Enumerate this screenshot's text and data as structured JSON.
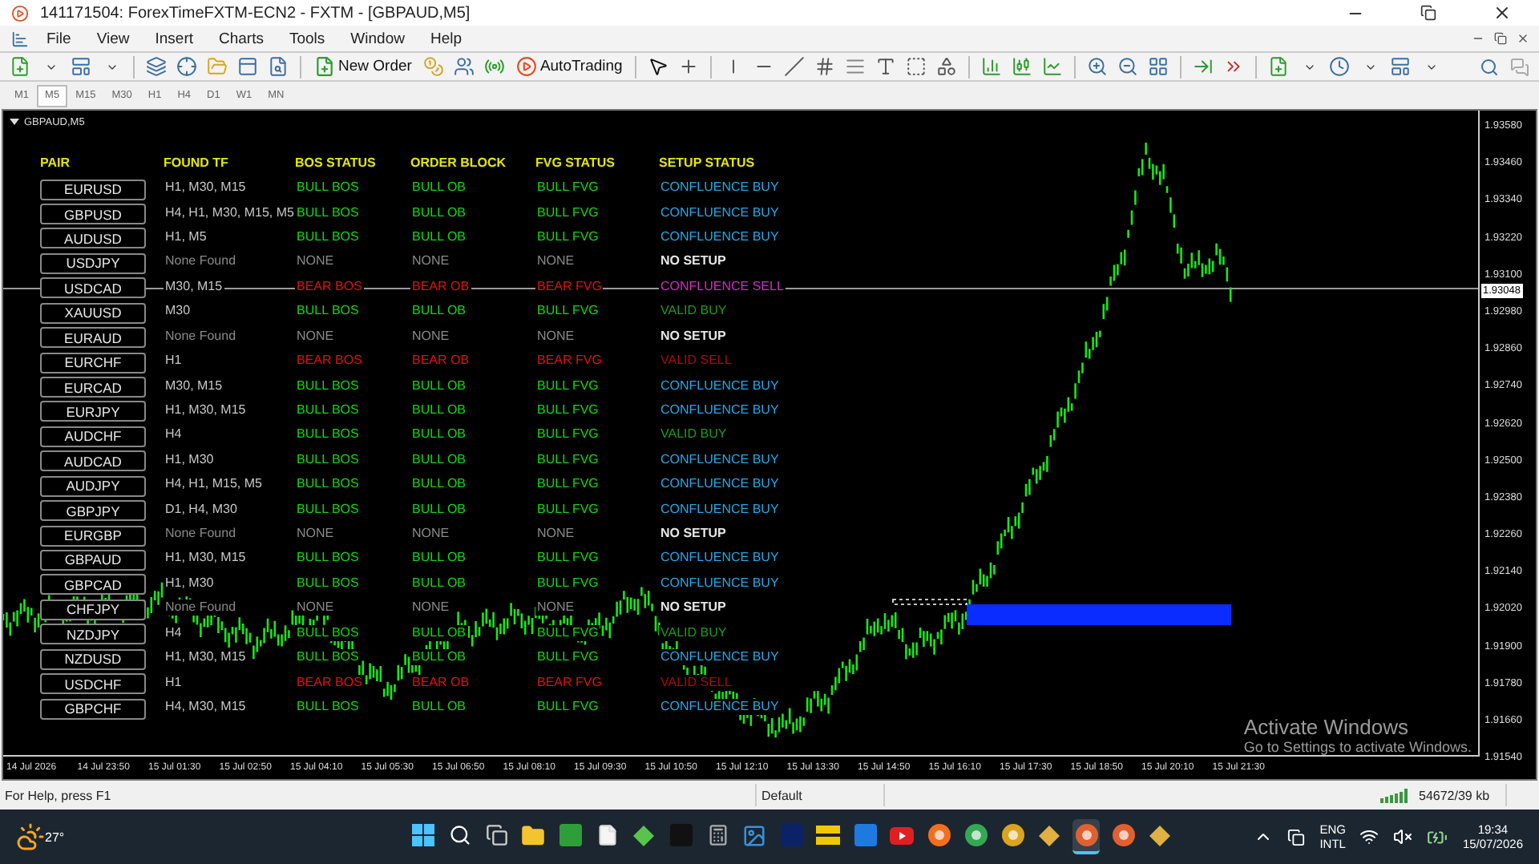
{
  "window": {
    "title": "141171504: ForexTimeFXTM-ECN2 - FXTM - [GBPAUD,M5]"
  },
  "menu": [
    "File",
    "View",
    "Insert",
    "Charts",
    "Tools",
    "Window",
    "Help"
  ],
  "toolbar": {
    "new_order": "New Order",
    "auto_trading": "AutoTrading"
  },
  "timeframes": [
    {
      "label": "M1",
      "selected": false
    },
    {
      "label": "M5",
      "selected": true
    },
    {
      "label": "M15",
      "selected": false
    },
    {
      "label": "M30",
      "selected": false
    },
    {
      "label": "H1",
      "selected": false
    },
    {
      "label": "H4",
      "selected": false
    },
    {
      "label": "D1",
      "selected": false
    },
    {
      "label": "W1",
      "selected": false
    },
    {
      "label": "MN",
      "selected": false
    }
  ],
  "chart": {
    "label": "GBPAUD,M5",
    "table": {
      "columns": [
        "PAIR",
        "FOUND TF",
        "BOS STATUS",
        "ORDER BLOCK",
        "FVG STATUS",
        "SETUP STATUS"
      ],
      "rows": [
        {
          "pair": "EURUSD",
          "found_tf": "H1, M30, M15",
          "kind": "bull",
          "bos": "BULL BOS",
          "ob": "BULL OB",
          "fvg": "BULL FVG",
          "setup": {
            "text": "CONFLUENCE BUY",
            "kind": "buy"
          }
        },
        {
          "pair": "GBPUSD",
          "found_tf": "H4, H1, M30, M15, M5",
          "kind": "bull",
          "bos": "BULL BOS",
          "ob": "BULL OB",
          "fvg": "BULL FVG",
          "setup": {
            "text": "CONFLUENCE BUY",
            "kind": "buy"
          }
        },
        {
          "pair": "AUDUSD",
          "found_tf": "H1, M5",
          "kind": "bull",
          "bos": "BULL BOS",
          "ob": "BULL OB",
          "fvg": "BULL FVG",
          "setup": {
            "text": "CONFLUENCE BUY",
            "kind": "buy"
          }
        },
        {
          "pair": "USDJPY",
          "found_tf": "None Found",
          "kind": "none",
          "bos": "NONE",
          "ob": "NONE",
          "fvg": "NONE",
          "setup": {
            "text": "NO SETUP",
            "kind": "none"
          }
        },
        {
          "pair": "USDCAD",
          "found_tf": "M30, M15",
          "kind": "bear",
          "bos": "BEAR BOS",
          "ob": "BEAR OB",
          "fvg": "BEAR FVG",
          "setup": {
            "text": "CONFLUENCE SELL",
            "kind": "sell"
          }
        },
        {
          "pair": "XAUUSD",
          "found_tf": "M30",
          "kind": "bull",
          "bos": "BULL BOS",
          "ob": "BULL OB",
          "fvg": "BULL FVG",
          "setup": {
            "text": "VALID BUY",
            "kind": "valid"
          }
        },
        {
          "pair": "EURAUD",
          "found_tf": "None Found",
          "kind": "none",
          "bos": "NONE",
          "ob": "NONE",
          "fvg": "NONE",
          "setup": {
            "text": "NO SETUP",
            "kind": "none"
          }
        },
        {
          "pair": "EURCHF",
          "found_tf": "H1",
          "kind": "bear",
          "bos": "BEAR BOS",
          "ob": "BEAR OB",
          "fvg": "BEAR FVG",
          "setup": {
            "text": "VALID SELL",
            "kind": "weak"
          }
        },
        {
          "pair": "EURCAD",
          "found_tf": "M30, M15",
          "kind": "bull",
          "bos": "BULL BOS",
          "ob": "BULL OB",
          "fvg": "BULL FVG",
          "setup": {
            "text": "CONFLUENCE BUY",
            "kind": "buy"
          }
        },
        {
          "pair": "EURJPY",
          "found_tf": "H1, M30, M15",
          "kind": "bull",
          "bos": "BULL BOS",
          "ob": "BULL OB",
          "fvg": "BULL FVG",
          "setup": {
            "text": "CONFLUENCE BUY",
            "kind": "buy"
          }
        },
        {
          "pair": "AUDCHF",
          "found_tf": "H4",
          "kind": "bull",
          "bos": "BULL BOS",
          "ob": "BULL OB",
          "fvg": "BULL FVG",
          "setup": {
            "text": "VALID BUY",
            "kind": "valid"
          }
        },
        {
          "pair": "AUDCAD",
          "found_tf": "H1, M30",
          "kind": "bull",
          "bos": "BULL BOS",
          "ob": "BULL OB",
          "fvg": "BULL FVG",
          "setup": {
            "text": "CONFLUENCE BUY",
            "kind": "buy"
          }
        },
        {
          "pair": "AUDJPY",
          "found_tf": "H4, H1, M15, M5",
          "kind": "bull",
          "bos": "BULL BOS",
          "ob": "BULL OB",
          "fvg": "BULL FVG",
          "setup": {
            "text": "CONFLUENCE BUY",
            "kind": "buy"
          }
        },
        {
          "pair": "GBPJPY",
          "found_tf": "D1, H4, M30",
          "kind": "bull",
          "bos": "BULL BOS",
          "ob": "BULL OB",
          "fvg": "BULL FVG",
          "setup": {
            "text": "CONFLUENCE BUY",
            "kind": "buy"
          }
        },
        {
          "pair": "EURGBP",
          "found_tf": "None Found",
          "kind": "none",
          "bos": "NONE",
          "ob": "NONE",
          "fvg": "NONE",
          "setup": {
            "text": "NO SETUP",
            "kind": "none"
          }
        },
        {
          "pair": "GBPAUD",
          "found_tf": "H1, M30, M15",
          "kind": "bull",
          "bos": "BULL BOS",
          "ob": "BULL OB",
          "fvg": "BULL FVG",
          "setup": {
            "text": "CONFLUENCE BUY",
            "kind": "buy"
          }
        },
        {
          "pair": "GBPCAD",
          "found_tf": "H1, M30",
          "kind": "bull",
          "bos": "BULL BOS",
          "ob": "BULL OB",
          "fvg": "BULL FVG",
          "setup": {
            "text": "CONFLUENCE BUY",
            "kind": "buy"
          }
        },
        {
          "pair": "CHFJPY",
          "found_tf": "None Found",
          "kind": "none",
          "bos": "NONE",
          "ob": "NONE",
          "fvg": "NONE",
          "setup": {
            "text": "NO SETUP",
            "kind": "none"
          }
        },
        {
          "pair": "NZDJPY",
          "found_tf": "H4",
          "kind": "bull",
          "bos": "BULL BOS",
          "ob": "BULL OB",
          "fvg": "BULL FVG",
          "setup": {
            "text": "VALID BUY",
            "kind": "valid"
          }
        },
        {
          "pair": "NZDUSD",
          "found_tf": "H1, M30, M15",
          "kind": "bull",
          "bos": "BULL BOS",
          "ob": "BULL OB",
          "fvg": "BULL FVG",
          "setup": {
            "text": "CONFLUENCE BUY",
            "kind": "buy"
          }
        },
        {
          "pair": "USDCHF",
          "found_tf": "H1",
          "kind": "bear",
          "bos": "BEAR BOS",
          "ob": "BEAR OB",
          "fvg": "BEAR FVG",
          "setup": {
            "text": "VALID SELL",
            "kind": "weak"
          }
        },
        {
          "pair": "GBPCHF",
          "found_tf": "H4, M30, M15",
          "kind": "bull",
          "bos": "BULL BOS",
          "ob": "BULL OB",
          "fvg": "BULL FVG",
          "setup": {
            "text": "CONFLUENCE BUY",
            "kind": "buy"
          }
        }
      ]
    },
    "price_ticks": [
      "1.93580",
      "1.93460",
      "1.93340",
      "1.93220",
      "1.93100",
      "1.92980",
      "1.92860",
      "1.92740",
      "1.92620",
      "1.92500",
      "1.92380",
      "1.92260",
      "1.92140",
      "1.92020",
      "1.91900",
      "1.91780",
      "1.91660",
      "1.91540"
    ],
    "current_price": "1.93048",
    "time_labels": [
      "14 Jul 2026",
      "14 Jul 23:50",
      "15 Jul 01:30",
      "15 Jul 02:50",
      "15 Jul 04:10",
      "15 Jul 05:30",
      "15 Jul 06:50",
      "15 Jul 08:10",
      "15 Jul 09:30",
      "15 Jul 10:50",
      "15 Jul 12:10",
      "15 Jul 13:30",
      "15 Jul 14:50",
      "15 Jul 16:10",
      "15 Jul 17:30",
      "15 Jul 18:50",
      "15 Jul 20:10",
      "15 Jul 21:30"
    ]
  },
  "os_notice": {
    "title": "Activate Windows",
    "text": "Go to Settings to activate Windows."
  },
  "status_bar": {
    "help": "For Help, press F1",
    "profile": "Default",
    "traffic": "54672/39 kb"
  },
  "taskbar": {
    "weather": "27°",
    "language": "ENG",
    "layout": "INTL",
    "time": "19:34",
    "date": "15/07/2026"
  }
}
